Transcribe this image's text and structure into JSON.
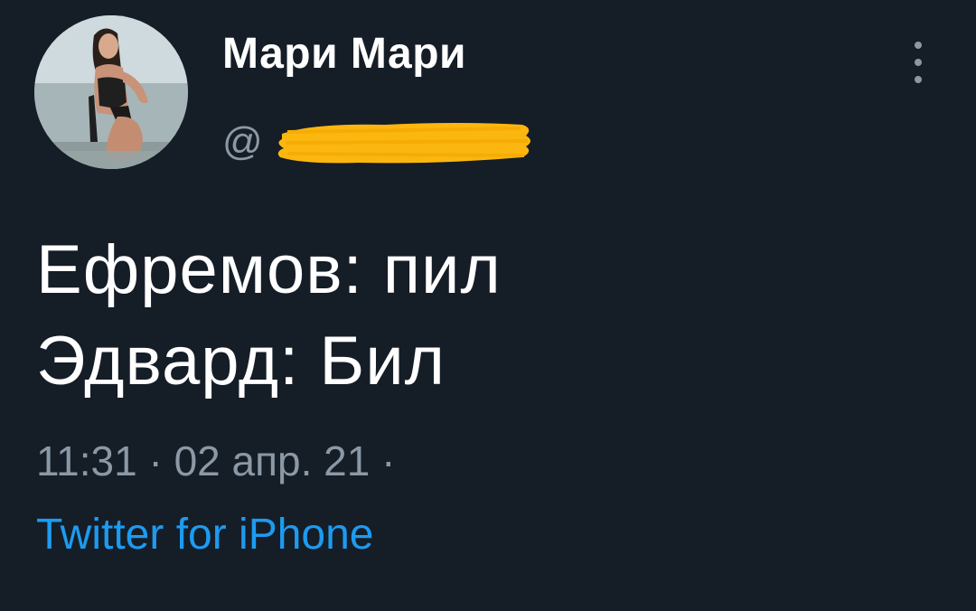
{
  "tweet": {
    "author": {
      "display_name": "Мари Мари",
      "handle_prefix": "@"
    },
    "text_lines": [
      "Ефремов: пил",
      "Эдвард: Бил"
    ],
    "time": "11:31",
    "separator": "·",
    "date": "02 апр. 21",
    "source": "Twitter for iPhone"
  },
  "colors": {
    "background": "#151d27",
    "text": "#ffffff",
    "secondary_text": "#8b98a5",
    "link": "#1d9bf0",
    "redaction": "#fbb710"
  },
  "icons": {
    "more": "more-vertical-icon"
  }
}
